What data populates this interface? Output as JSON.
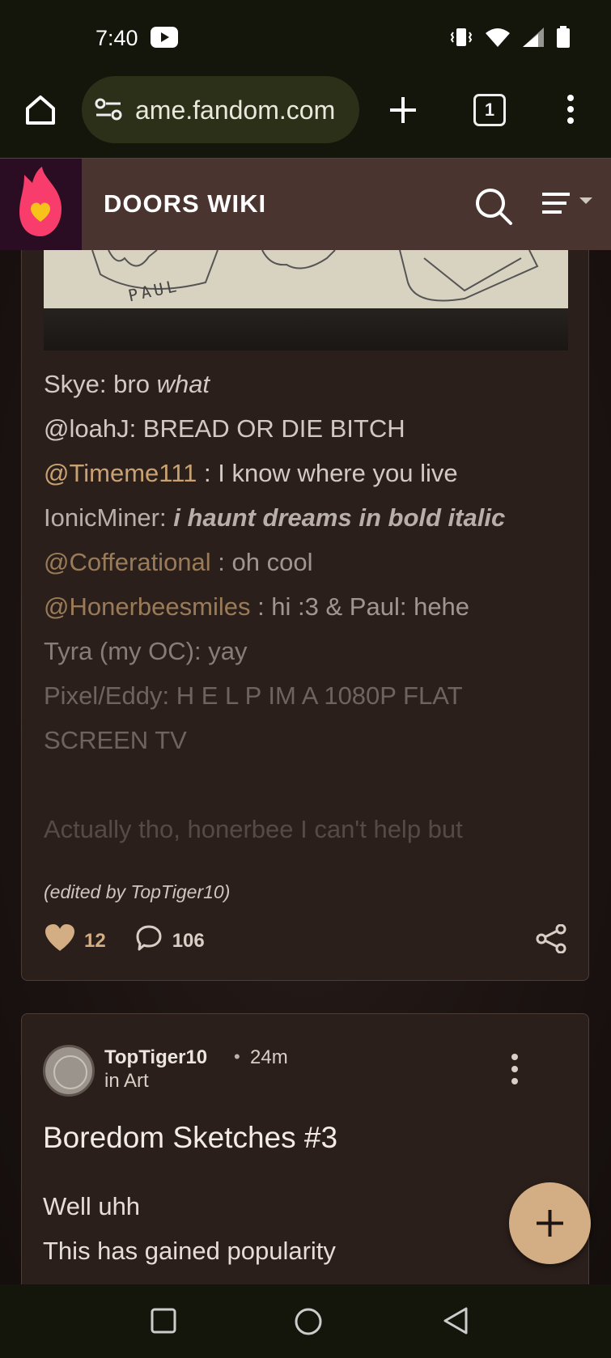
{
  "status_bar": {
    "time": "7:40"
  },
  "browser": {
    "url": "ame.fandom.com",
    "tab_count": "1"
  },
  "wiki_header": {
    "title": "DOORS WIKI"
  },
  "sketch_label": "PAUL",
  "post1": {
    "lines": [
      {
        "prefix": "Skye: bro ",
        "italic": "what"
      },
      {
        "text": "@loahJ: BREAD OR DIE BITCH"
      },
      {
        "mention": "@Timeme111",
        "text": " : I know where you live"
      },
      {
        "prefix": "IonicMiner: ",
        "bold_italic": "i haunt dreams in bold italic"
      },
      {
        "mention": "@Cofferational",
        "text": " : oh cool"
      },
      {
        "mention": "@Honerbeesmiles",
        "text": " : hi :3 & Paul: hehe"
      },
      {
        "text": "Tyra (my OC): yay"
      },
      {
        "text": "Pixel/Eddy: H E L P IM A 1080P FLAT"
      },
      {
        "text": "SCREEN TV"
      },
      {
        "text": ""
      },
      {
        "text": "Actually tho, honerbee I can't help but"
      }
    ],
    "edited_note": "(edited by TopTiger10)",
    "likes": "12",
    "comments": "106"
  },
  "post2": {
    "author": "TopTiger10",
    "separator": "•",
    "time_ago": "24m",
    "category": "in Art",
    "title": "Boredom Sketches #3",
    "body": [
      "Well uhh",
      "This has gained popularity"
    ]
  },
  "colors": {
    "accent": "#d3ae84",
    "mention": "#c9a273",
    "header_bg": "#4a342f"
  }
}
